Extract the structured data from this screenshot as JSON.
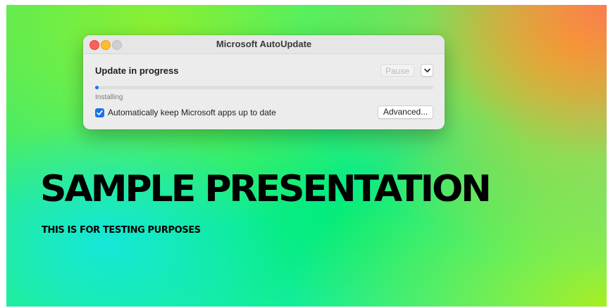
{
  "window": {
    "title": "Microsoft AutoUpdate",
    "status_heading": "Update in progress",
    "pause_label": "Pause",
    "progress_fraction": 0.01,
    "progress_text": "Installing",
    "auto_update_label": "Automatically keep Microsoft apps up to date",
    "auto_update_checked": true,
    "advanced_label": "Advanced..."
  },
  "slide": {
    "title": "SAMPLE PRESENTATION",
    "subtitle": "THIS IS FOR TESTING PURPOSES"
  },
  "colors": {
    "accent": "#1a73e8",
    "close": "#fe5f57",
    "minimize": "#febc2e",
    "zoom_inactive": "#cfcfcf"
  },
  "icons": {
    "dropdown": "chevron-down-icon",
    "checkbox": "checkmark-icon"
  }
}
